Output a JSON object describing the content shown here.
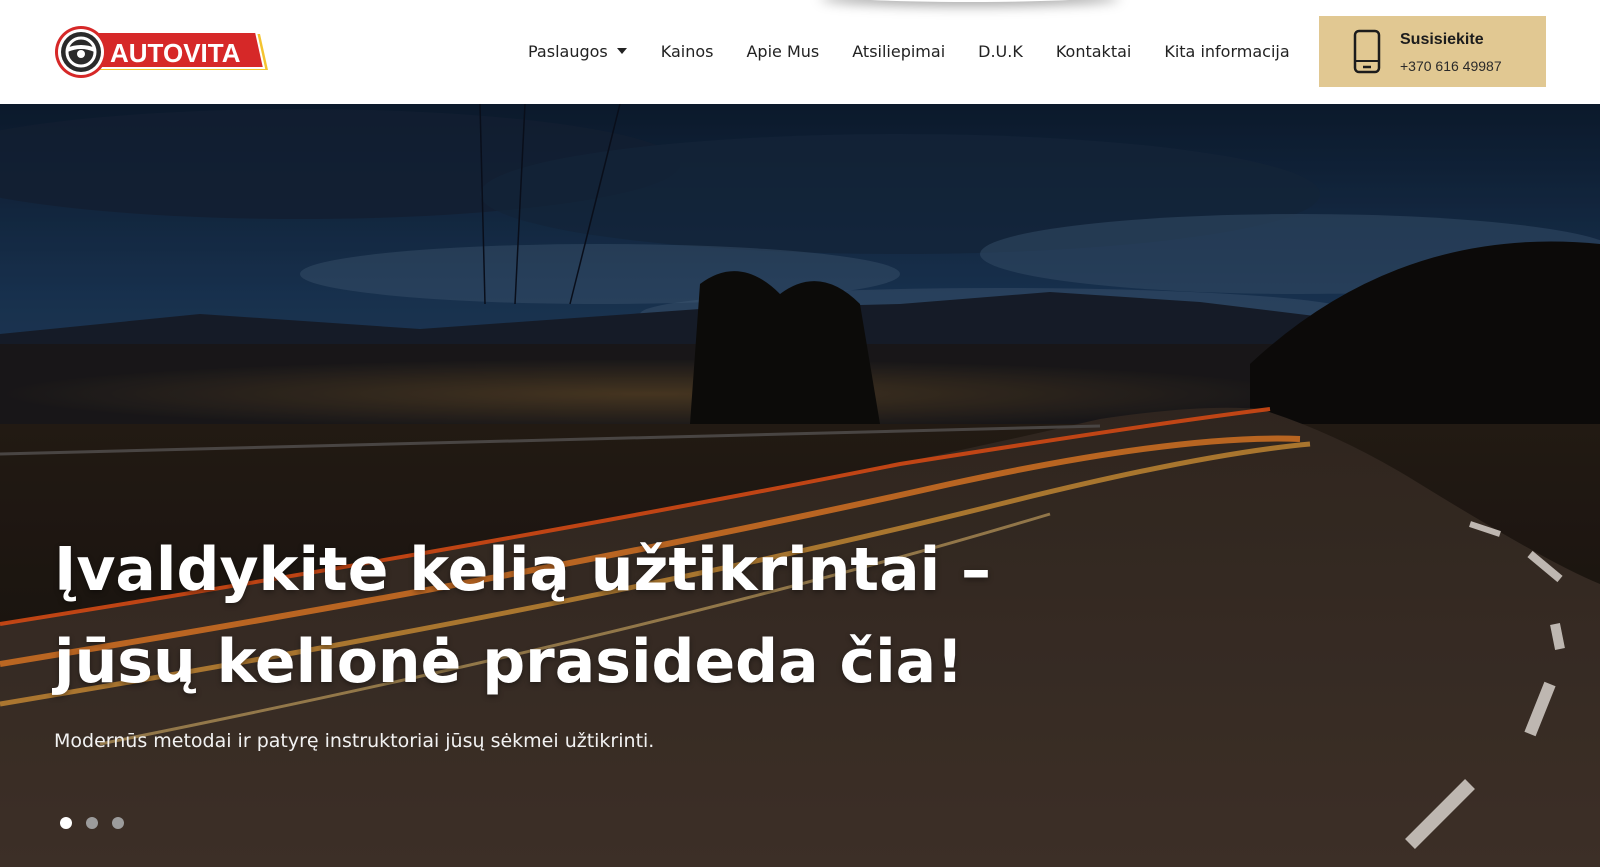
{
  "header": {
    "logo_text": "AUTOVITA",
    "nav": [
      {
        "label": "Paslaugos",
        "has_dropdown": true
      },
      {
        "label": "Kainos"
      },
      {
        "label": "Apie Mus"
      },
      {
        "label": "Atsiliepimai"
      },
      {
        "label": "D.U.K"
      },
      {
        "label": "Kontaktai"
      },
      {
        "label": "Kita informacija"
      }
    ],
    "contact": {
      "title": "Susisiekite",
      "phone": "+370 616 49987",
      "icon": "mobile-phone-icon"
    }
  },
  "hero": {
    "headline": "Įvaldykite kelią užtikrintai – jūsų kelionė prasideda čia!",
    "subline": "Modernūs metodai ir patyrę instruktoriai jūsų sėkmei užtikrinti.",
    "slides_total": 3,
    "active_slide": 1
  },
  "colors": {
    "contact_bg": "#e1c892",
    "logo_red": "#d62828",
    "text_dark": "#222222"
  }
}
